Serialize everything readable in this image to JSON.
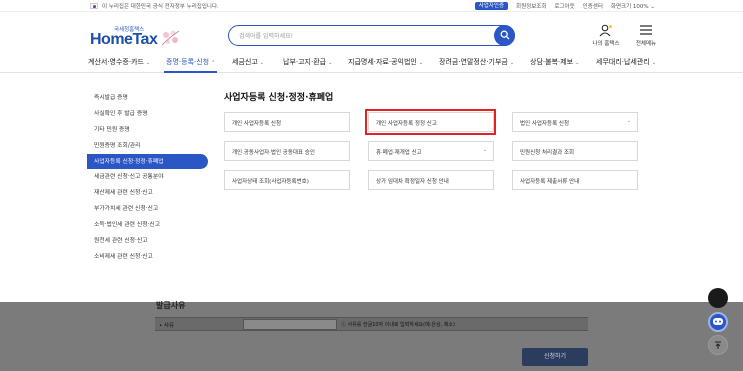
{
  "topbar": {
    "notice": "이 누리집은 대한민국 공식 전자정부 누리집입니다.",
    "links": {
      "certificate": "사업자인증",
      "member_info": "회원정보조회",
      "logout": "로그아웃",
      "cert_center": "인증센터",
      "zoom_label": "화면크기",
      "zoom_value": "100%"
    }
  },
  "header": {
    "logo_sub": "국세청홈택스",
    "logo_main": "HomeTax",
    "search_placeholder": "검색어를 입력하세요!",
    "my_hometax": "나의 홈택스",
    "all_menu": "전체메뉴"
  },
  "nav": {
    "items": [
      "계산서·영수증·카드",
      "증명·등록·신청",
      "세금신고",
      "납부·고지·환급",
      "지급명세·자료·공익법인",
      "장려금·연말정산·기부금",
      "상담·불복·제보",
      "세무대리·납세관리"
    ]
  },
  "sidebar": {
    "items": [
      "즉시발급 증명",
      "사실확인 후 발급 증명",
      "기타 민원 증명",
      "민원증명 조회/관리",
      "사업자등록 신청·정정·휴폐업",
      "세금관련 신청·신고 공통분야",
      "재산제세 관련 신청·신고",
      "부가가치세 관련 신청·신고",
      "소득·법인세 관련 신청·신고",
      "원천세 관련 신청·신고",
      "소비제세 관련 신청·신고"
    ]
  },
  "panel": {
    "title": "사업자등록 신청·정정·휴폐업",
    "cards": [
      "개인 사업자등록 신청",
      "개인 사업자등록 정정 신고",
      "법인 사업자등록 신청",
      "개인 공동사업자·법인 공동대표 승인",
      "휴·폐업·재개업 신고",
      "민원신청 처리결과 조회",
      "사업자상태 조회(사업자등록번호)",
      "상가 임대차 확정일자 신청 안내",
      "사업자등록 제출서류 안내"
    ]
  },
  "background_form": {
    "title": "발급사유",
    "reason_label": "• 사유",
    "reason_hint": "사유를 한글10자 이내로 입력하세요(예:은상, 제소)",
    "apply_button": "신청하기"
  },
  "colors": {
    "brand_blue": "#2a56c6",
    "highlight_red": "#e02424",
    "dim_overlay": "#7b7b7b"
  }
}
